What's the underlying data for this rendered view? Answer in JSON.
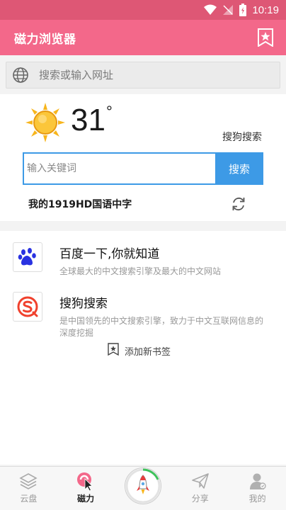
{
  "status_bar": {
    "time": "10:19",
    "icons": [
      "wifi-icon",
      "no-signal-icon",
      "battery-charging-icon"
    ]
  },
  "header": {
    "title": "磁力浏览器",
    "bookmark_icon": "bookmark-star-icon"
  },
  "address_bar": {
    "placeholder": "搜索或输入网址",
    "icon": "globe-icon"
  },
  "weather": {
    "temperature": "31",
    "unit": "°",
    "icon": "sunny-icon"
  },
  "search": {
    "engine_label": "搜狗搜索",
    "placeholder": "输入关键词",
    "button_label": "搜索"
  },
  "hot_topic": {
    "text": "我的1919HD国语中字",
    "refresh_icon": "refresh-icon"
  },
  "bookmarks": [
    {
      "name": "百度一下,你就知道",
      "desc": "全球最大的中文搜索引擎及最大的中文网站",
      "icon": "baidu-paw-icon"
    },
    {
      "name": "搜狗搜索",
      "desc": "是中国领先的中文搜索引擎，致力于中文互联网信息的深度挖掘",
      "icon": "sogou-icon"
    }
  ],
  "add_bookmark_label": "添加新书签",
  "tabs": [
    {
      "label": "云盘",
      "icon": "layers-icon"
    },
    {
      "label": "磁力",
      "icon": "magnet-cursor-icon",
      "active": true
    },
    {
      "label": "",
      "icon": "rocket-icon"
    },
    {
      "label": "分享",
      "icon": "paper-plane-icon"
    },
    {
      "label": "我的",
      "icon": "user-icon"
    }
  ],
  "colors": {
    "status_bar": "#de5775",
    "app_bar": "#f3688a",
    "accent_blue": "#3d9ae6",
    "baidu_blue": "#2932e1",
    "sogou_red": "#f0412d"
  }
}
